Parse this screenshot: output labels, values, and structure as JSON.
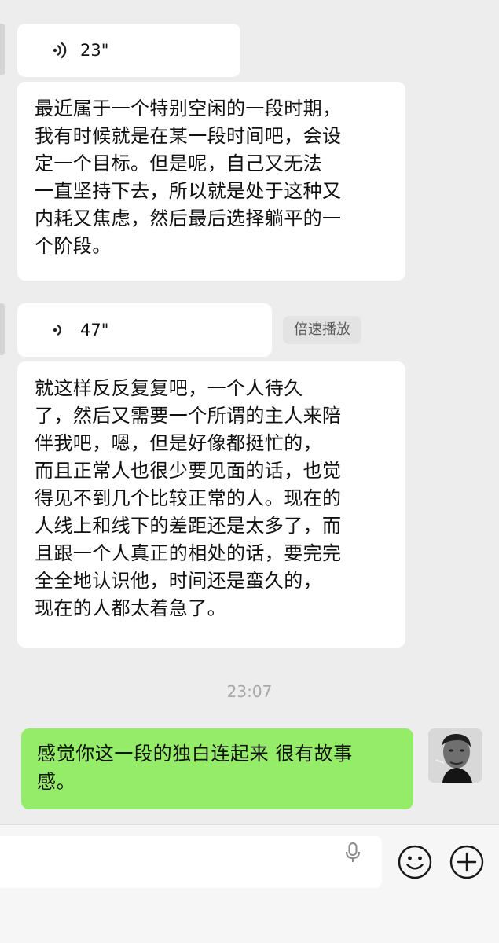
{
  "messages": [
    {
      "type": "voice",
      "duration": "23\""
    },
    {
      "type": "text",
      "text": "最近属于一个特别空闲的一段时期，\n我有时候就是在某一段时间吧，会设\n定一个目标。但是呢，自己又无法\n一直坚持下去，所以就是处于这种又\n内耗又焦虑，然后最后选择躺平的一\n个阶段。"
    },
    {
      "type": "voice",
      "duration": "47\"",
      "action": "倍速播放"
    },
    {
      "type": "text",
      "text": "就这样反反复复吧，一个人待久\n了，然后又需要一个所谓的主人来陪\n伴我吧，嗯，但是好像都挺忙的，\n而且正常人也很少要见面的话，也觉\n得见不到几个比较正常的人。现在的\n人线上和线下的差距还是太多了，而\n且跟一个人真正的相处的话，要完完\n全全地认识他，时间还是蛮久的，\n现在的人都太着急了。"
    }
  ],
  "timestamp": "23:07",
  "my_message": "感觉你这一段的独白连起来 很有故事\n感。",
  "colors": {
    "background": "#ededed",
    "incoming_bubble": "#ffffff",
    "outgoing_bubble": "#95ec69",
    "timestamp_text": "#a8a8a8"
  },
  "icons": [
    "voice-wave-icon",
    "microphone-icon",
    "emoji-icon",
    "plus-icon"
  ]
}
